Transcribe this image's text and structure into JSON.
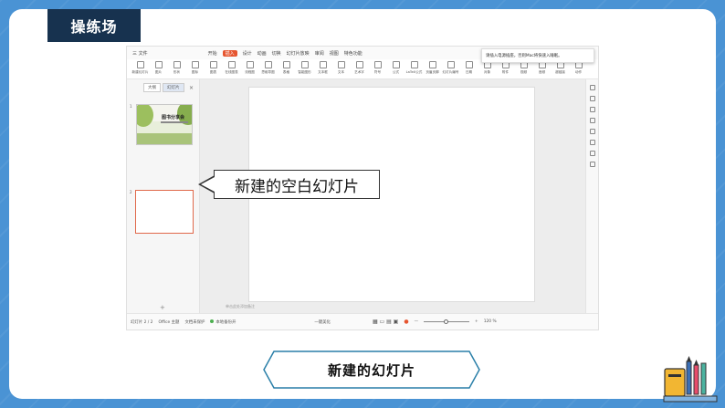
{
  "title_tag": "操练场",
  "menu": {
    "items": [
      "三 文件",
      "开始",
      "插入",
      "设计",
      "动画",
      "切换",
      "幻灯片放映",
      "审阅",
      "视图",
      "特色功能"
    ],
    "active_index": 2
  },
  "notice": "请插入电源插座，否则Mac将快速入睡眠。",
  "ribbon": [
    "新建幻灯片",
    "图片",
    "形状",
    "图标",
    "图表",
    "在线图表",
    "流程图",
    "思维导图",
    "表格",
    "智能图形",
    "文本框",
    "文本",
    "艺术字",
    "符号",
    "公式",
    "LaTeX公式",
    "页眉页脚",
    "幻灯片编号",
    "日期",
    "对象",
    "附件",
    "视频",
    "音频",
    "超链接",
    "动作"
  ],
  "panel": {
    "tab_outline": "大纲",
    "tab_slides": "幻灯片",
    "close": "×"
  },
  "thumbs": {
    "num1": "1",
    "num2": "2",
    "slide1_title": "图书分享会"
  },
  "add_slide": "+",
  "notes_placeholder": "单击此处添加备注",
  "status": {
    "slide_count": "幻灯片 2 / 2",
    "theme": "Office 主题",
    "protect": "文档未保护",
    "saved": "本地备份开",
    "beautify": "一键美化",
    "zoom": "120 %"
  },
  "callout": "新建的空白幻灯片",
  "bottom_button": "新建的幻灯片",
  "colors": {
    "background": "#4a93d4",
    "title_tag": "#17324f",
    "accent": "#e6552f",
    "button_border": "#2a7fa8"
  }
}
